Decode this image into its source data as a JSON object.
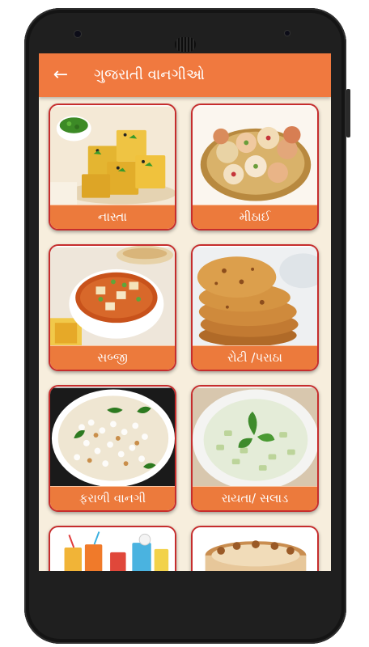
{
  "app": {
    "title": "ગુજરાતી વાનગીઓ",
    "back_icon": "arrow-left-icon",
    "accent": "#f0793f",
    "background": "#f7eedd"
  },
  "categories": [
    {
      "label": "નાસ્તા",
      "image": "dhokla-photo"
    },
    {
      "label": "મીઠાઈ",
      "image": "sweets-platter-photo"
    },
    {
      "label": "સબ્જી",
      "image": "paneer-curry-photo"
    },
    {
      "label": "રોટી /પરાઠા",
      "image": "paratha-stack-photo"
    },
    {
      "label": "ફરાળી વાનગી",
      "image": "sabudana-khichdi-photo"
    },
    {
      "label": "રાયતા/ સલાડ",
      "image": "cucumber-raita-photo"
    },
    {
      "label": "",
      "image": "drinks-photo"
    },
    {
      "label": "",
      "image": "cake-photo"
    }
  ]
}
